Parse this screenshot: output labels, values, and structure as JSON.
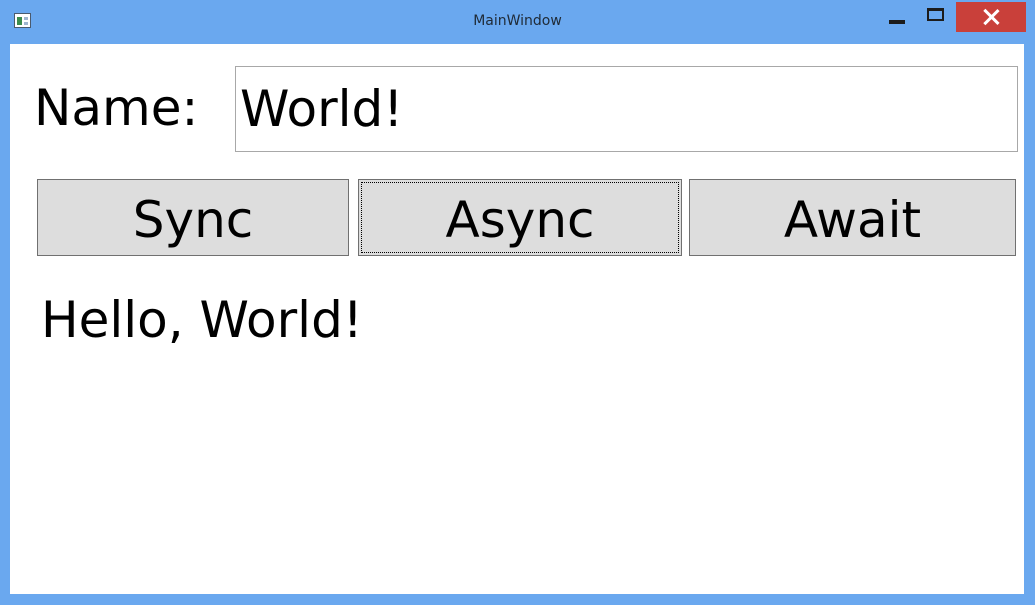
{
  "window": {
    "title": "MainWindow",
    "icons": {
      "app": "window-app-icon",
      "minimize": "minimize-icon",
      "maximize": "maximize-icon",
      "close": "close-icon"
    },
    "colors": {
      "frame": "#6aa8ef",
      "close_button": "#c9403a",
      "button_face": "#dddddd"
    }
  },
  "form": {
    "name_label": "Name:",
    "name_value": "World!"
  },
  "buttons": {
    "sync": "Sync",
    "async": "Async",
    "await": "Await"
  },
  "output": {
    "message": "Hello, World!"
  }
}
